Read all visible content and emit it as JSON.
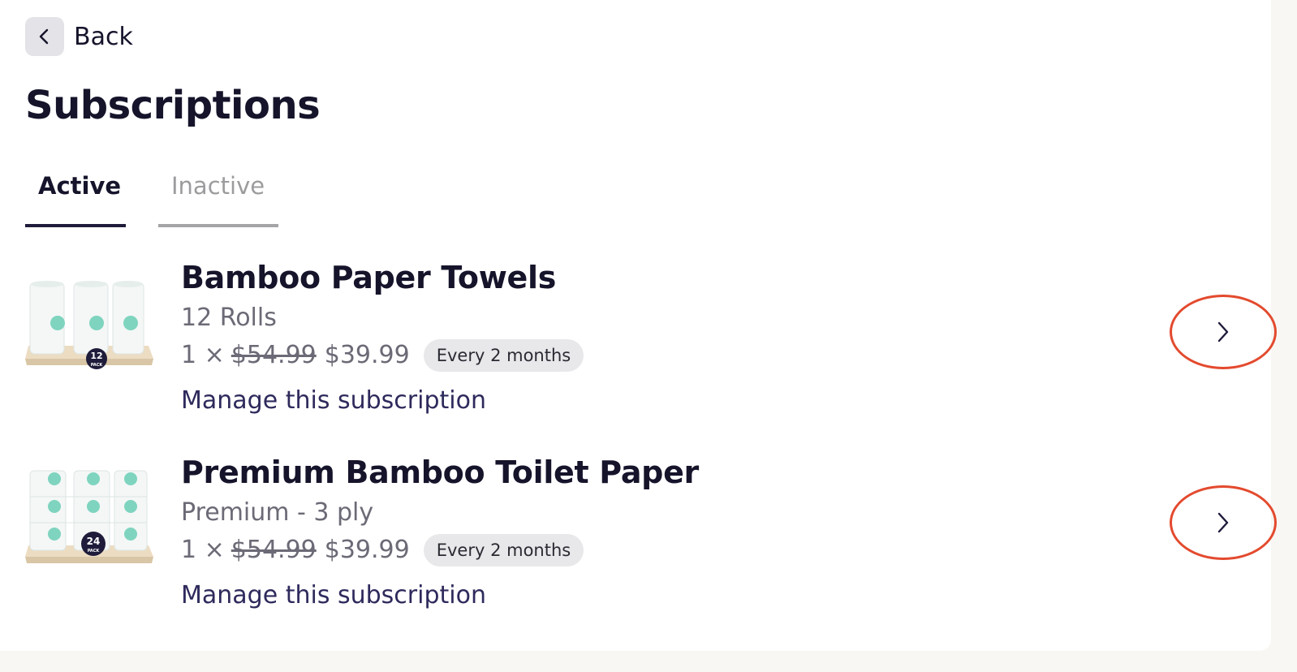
{
  "nav": {
    "back_label": "Back"
  },
  "page": {
    "title": "Subscriptions"
  },
  "tabs": [
    {
      "label": "Active",
      "selected": true
    },
    {
      "label": "Inactive",
      "selected": false
    }
  ],
  "subscriptions": [
    {
      "name": "Bamboo Paper Towels",
      "variant": "12 Rolls",
      "quantity": "1 ×",
      "original_price": "$54.99",
      "price": "$39.99",
      "frequency": "Every 2 months",
      "manage_label": "Manage this subscription",
      "pack_badge_number": "12",
      "pack_badge_word": "PACK",
      "icon": "paper-towel-pack"
    },
    {
      "name": "Premium Bamboo Toilet Paper",
      "variant": "Premium - 3 ply",
      "quantity": "1 ×",
      "original_price": "$54.99",
      "price": "$39.99",
      "frequency": "Every 2 months",
      "manage_label": "Manage this subscription",
      "pack_badge_number": "24",
      "pack_badge_word": "PACK",
      "icon": "toilet-paper-pack"
    }
  ],
  "colors": {
    "text_primary": "#15142b",
    "text_muted": "#6b6a76",
    "link": "#2e2a5c",
    "annotation_circle": "#e34a2e",
    "background": "#f8f7f4"
  }
}
